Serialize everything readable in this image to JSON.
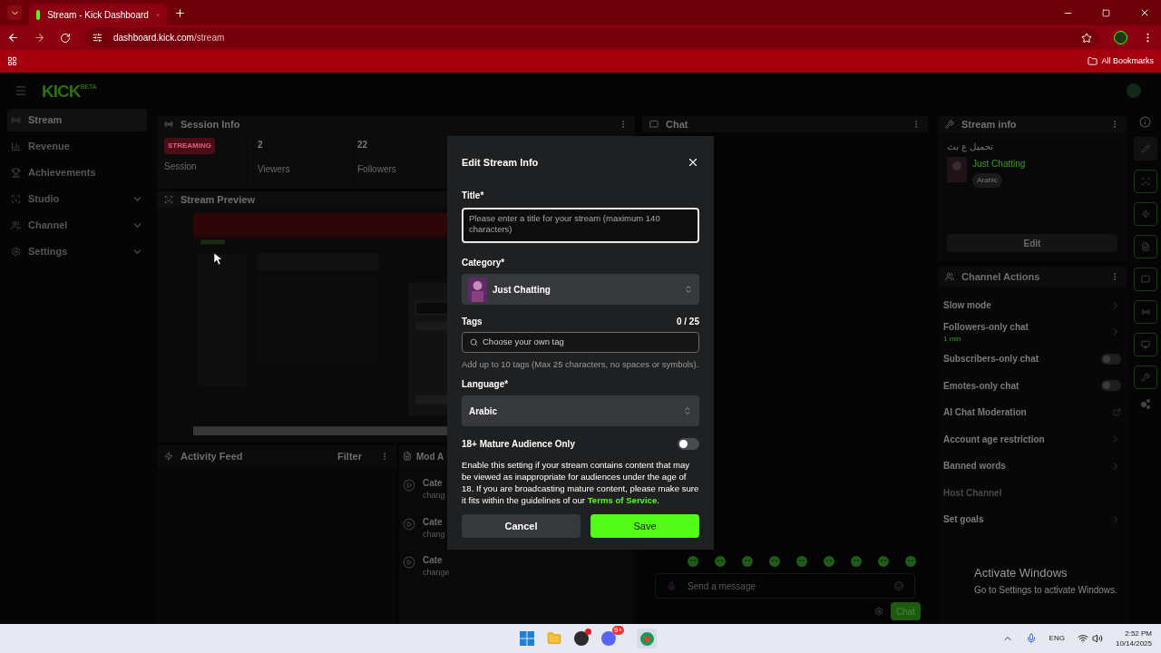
{
  "browser": {
    "tab_title": "Stream - Kick Dashboard",
    "url_host": "dashboard.kick.com",
    "url_path": "/stream",
    "bookmarks": "All Bookmarks"
  },
  "logo": {
    "text": "KICK",
    "badge": "BETA"
  },
  "sidebar": [
    {
      "label": "Stream",
      "selected": true,
      "expandable": false
    },
    {
      "label": "Revenue",
      "selected": false,
      "expandable": false
    },
    {
      "label": "Achievements",
      "selected": false,
      "expandable": false
    },
    {
      "label": "Studio",
      "selected": false,
      "expandable": true
    },
    {
      "label": "Channel",
      "selected": false,
      "expandable": true
    },
    {
      "label": "Settings",
      "selected": false,
      "expandable": true
    }
  ],
  "session_info": {
    "title": "Session Info",
    "badge": "STREAMING",
    "badge_label": "Session",
    "stats": [
      {
        "value": "2",
        "label": "Viewers"
      },
      {
        "value": "22",
        "label": "Followers"
      }
    ]
  },
  "stream_preview": {
    "title": "Stream Preview"
  },
  "activity_feed": {
    "title": "Activity Feed",
    "filter": "Filter"
  },
  "mod_actions": {
    "title": "Mod A",
    "items": [
      {
        "title": "Cate",
        "sub": "chang"
      },
      {
        "title": "Cate",
        "sub": "chang"
      },
      {
        "title": "Cate",
        "sub": "change"
      }
    ]
  },
  "chat": {
    "title": "Chat",
    "placeholder": "Send a message",
    "send": "Chat"
  },
  "stream_info": {
    "title": "Stream info",
    "stream_title": "تحميل ع بث",
    "category": "Just Chatting",
    "language": "Arabic",
    "edit": "Edit"
  },
  "channel_actions": {
    "title": "Channel Actions",
    "items": [
      {
        "kind": "link",
        "label": "Slow mode"
      },
      {
        "kind": "link",
        "label": "Followers-only chat",
        "sub": "1 min"
      },
      {
        "kind": "toggle",
        "label": "Subscribers-only chat",
        "on": false
      },
      {
        "kind": "toggle",
        "label": "Emotes-only chat",
        "on": false
      },
      {
        "kind": "external",
        "label": "AI Chat Moderation"
      },
      {
        "kind": "link",
        "label": "Account age restriction"
      },
      {
        "kind": "link",
        "label": "Banned words"
      },
      {
        "kind": "disabled",
        "label": "Host Channel"
      },
      {
        "kind": "link",
        "label": "Set goals"
      }
    ]
  },
  "modal": {
    "title": "Edit Stream Info",
    "title_label": "Title*",
    "title_placeholder": "Please enter a title for your stream (maximum 140 characters)",
    "category_label": "Category*",
    "category": "Just Chatting",
    "tags_label": "Tags",
    "tags_count": "0 / 25",
    "tags_placeholder": "Choose your own tag",
    "tags_hint": "Add up to 10 tags (Max 25 characters, no spaces or symbols).",
    "language_label": "Language*",
    "language": "Arabic",
    "mature_label": "18+ Mature Audience Only",
    "mature_on": false,
    "mature_text": "Enable this setting if your stream contains content that may be viewed as inappropriate for audiences under the age of 18. If you are broadcasting mature content, please make sure it fits within the guidelines of our",
    "tos": "Terms of Service",
    "tos_end": ".",
    "cancel": "Cancel",
    "save": "Save"
  },
  "activation": {
    "title": "Activate Windows",
    "text": "Go to Settings to activate Windows."
  },
  "taskbar": {
    "discord_badge": "9+",
    "lang": "ENG",
    "time": "2:52 PM",
    "date": "10/14/2025"
  }
}
